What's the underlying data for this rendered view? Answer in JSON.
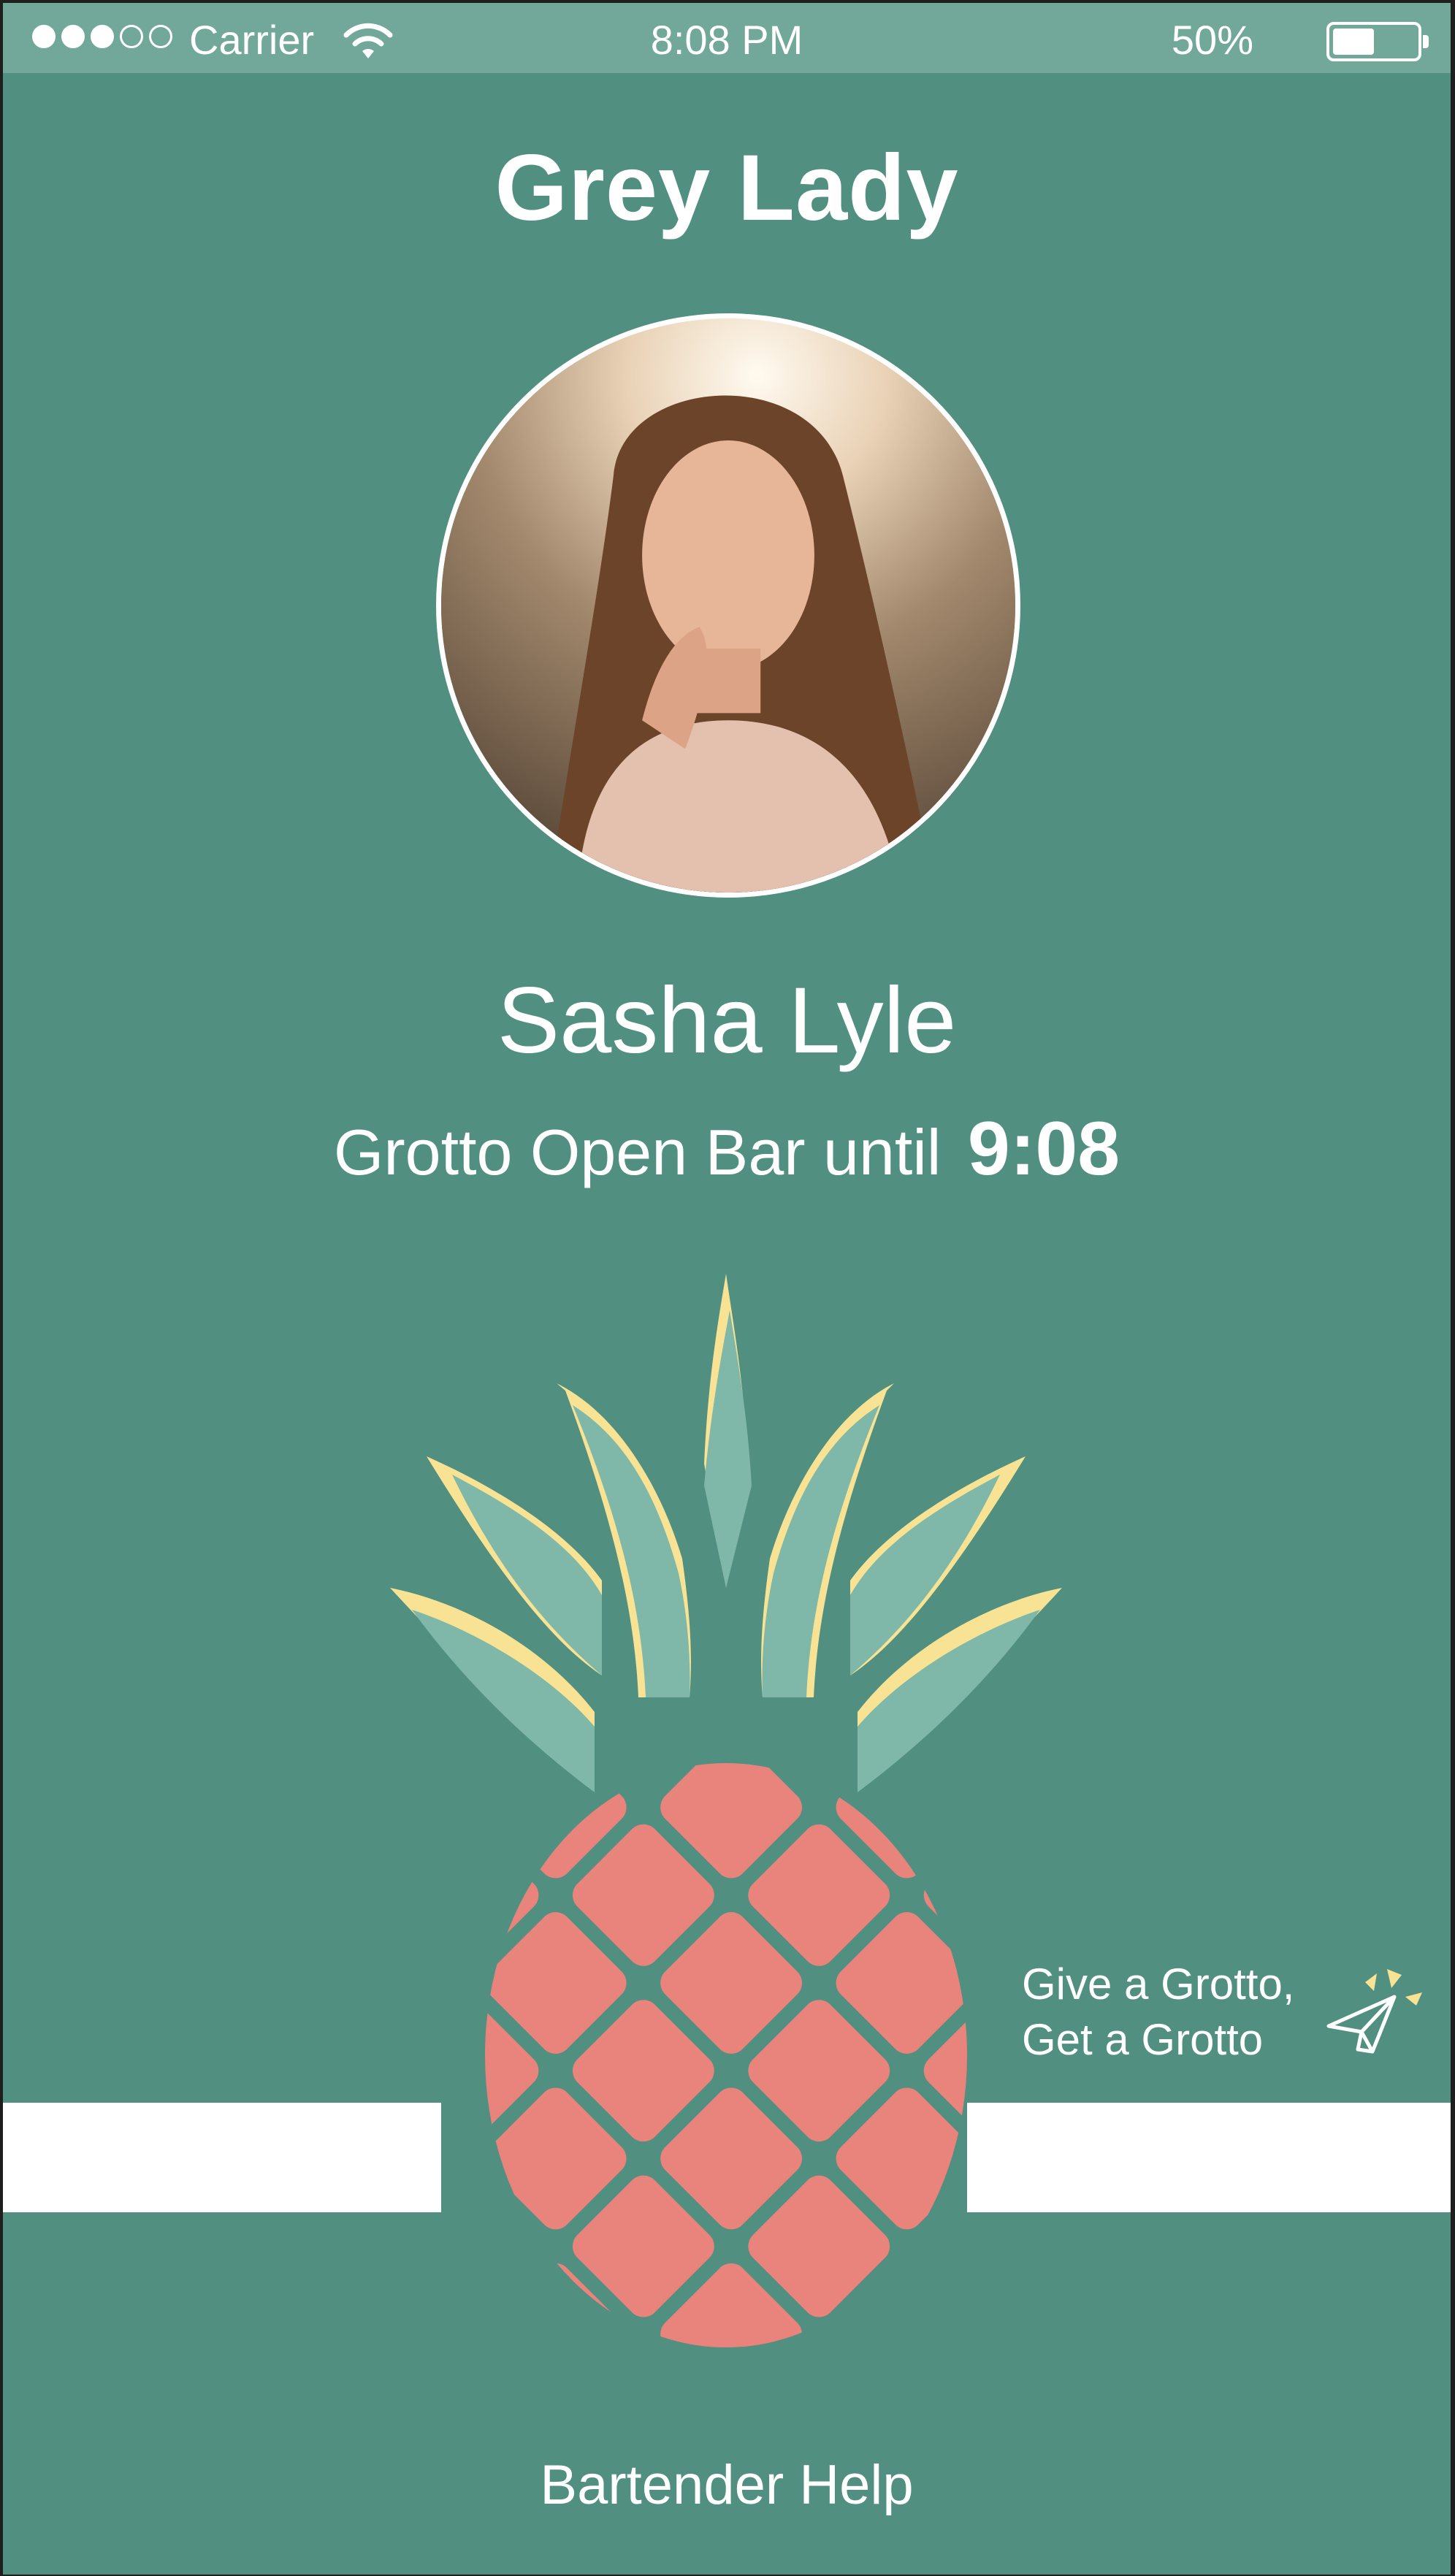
{
  "status_bar": {
    "carrier": "Carrier",
    "time": "8:08 PM",
    "battery_percent": "50%",
    "battery_level": 0.5,
    "signal_bars_filled": 3,
    "signal_bars_total": 5
  },
  "venue_title": "Grey Lady",
  "user": {
    "name": "Sasha Lyle"
  },
  "open_bar": {
    "prefix": "Grotto Open Bar until",
    "time": "9:08"
  },
  "give_grotto": {
    "line1": "Give a Grotto,",
    "line2": "Get a Grotto"
  },
  "help_label": "Bartender Help",
  "colors": {
    "background": "#518f80",
    "status_bar": "#72a89a",
    "leaf": "#7fb8a8",
    "leaf_highlight": "#f7e393",
    "fruit": "#e8847c"
  }
}
